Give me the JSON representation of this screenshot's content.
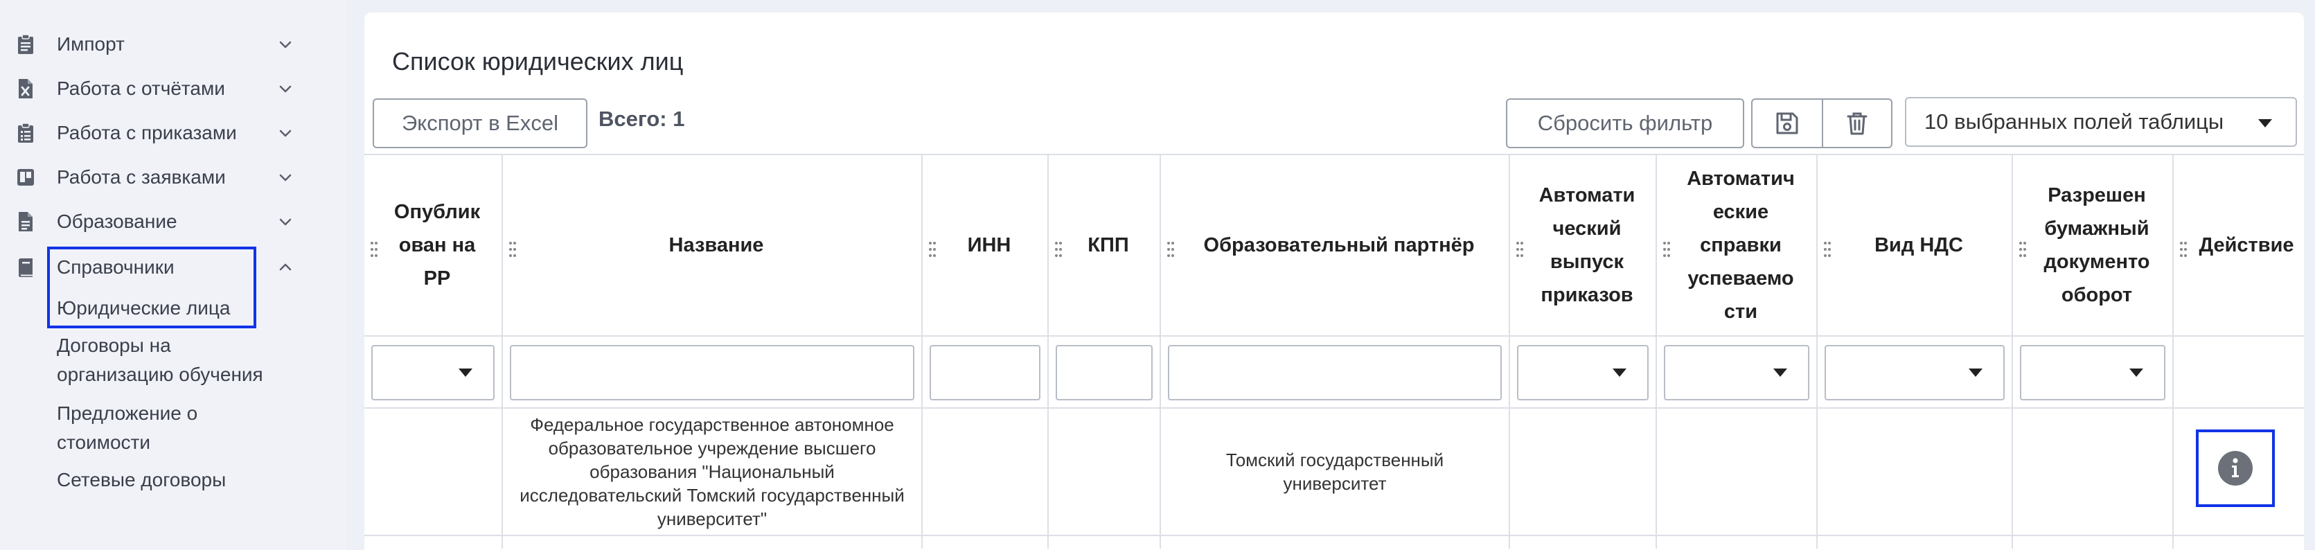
{
  "sidebar": {
    "items": [
      {
        "label": "Импорт",
        "icon": "clipboard-icon"
      },
      {
        "label": "Работа с отчётами",
        "icon": "excel-file-icon"
      },
      {
        "label": "Работа с приказами",
        "icon": "clipboard-list-icon"
      },
      {
        "label": "Работа с заявками",
        "icon": "trello-icon"
      },
      {
        "label": "Образование",
        "icon": "document-icon"
      },
      {
        "label": "Справочники",
        "icon": "book-icon"
      }
    ],
    "subitems": [
      "Юридические лица",
      "Договоры на организацию обучения",
      "Предложение о стоимости",
      "Сетевые договоры"
    ]
  },
  "page": {
    "title": "Список юридических лиц"
  },
  "toolbar": {
    "export_label": "Экспорт в Excel",
    "total_label": "Всего: 1",
    "reset_filter_label": "Сбросить фильтр",
    "fields_select_value": "10 выбранных полей таблицы"
  },
  "table": {
    "columns": [
      "Опубликован на РР",
      "Название",
      "ИНН",
      "КПП",
      "Образовательный партнёр",
      "Автоматический выпуск приказов",
      "Автоматические справки успеваемости",
      "Вид НДС",
      "Разрешен бумажный документооборот",
      "Действие"
    ],
    "header_lines": [
      "Опублик\nован на\nРР",
      "Название",
      "ИНН",
      "КПП",
      "Образовательный партнёр",
      "Автомати\nческий\nвыпуск\nприказов",
      "Автоматич\nеские\nсправки\nуспеваемо\nсти",
      "Вид НДС",
      "Разрешен\nбумажный\nдокументо\nоборот",
      "Действие"
    ],
    "rows": [
      {
        "published": "",
        "name": "Федеральное государственное автономное образовательное учреждение высшего образования \"Национальный исследовательский Томский государственный университет\"",
        "inn": "",
        "kpp": "",
        "partner": "Томский государственный университет",
        "auto_orders": "",
        "auto_certificates": "",
        "vat_type": "",
        "paper_docflow": "",
        "action_icon": "info-icon"
      }
    ]
  },
  "colors": {
    "highlight": "#1133e6",
    "background": "#eef0f7",
    "border": "#dcdfe6"
  }
}
